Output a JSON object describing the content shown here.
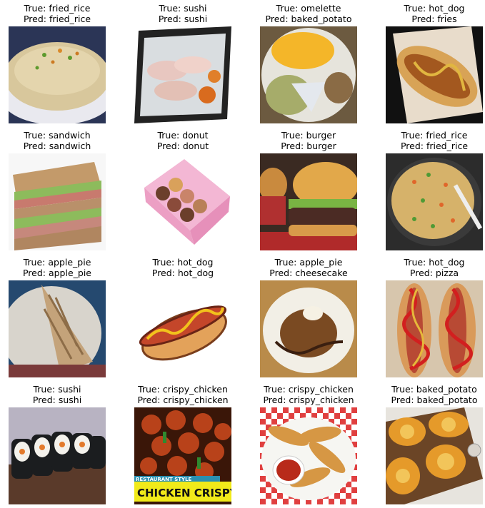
{
  "panels": [
    {
      "true_text": "True: fried_rice",
      "pred_text": "Pred: fried_rice",
      "image": "fried-rice-bowl"
    },
    {
      "true_text": "True: sushi",
      "pred_text": "Pred: sushi",
      "image": "sushi-plate"
    },
    {
      "true_text": "True: omelette",
      "pred_text": "Pred: baked_potato",
      "image": "omelette-plate"
    },
    {
      "true_text": "True: hot_dog",
      "pred_text": "Pred: fries",
      "image": "hot-dog-photo"
    },
    {
      "true_text": "True: sandwich",
      "pred_text": "Pred: sandwich",
      "image": "sandwich-stack"
    },
    {
      "true_text": "True: donut",
      "pred_text": "Pred: donut",
      "image": "donut-box"
    },
    {
      "true_text": "True: burger",
      "pred_text": "Pred: burger",
      "image": "burger-photo"
    },
    {
      "true_text": "True: fried_rice",
      "pred_text": "Pred: fried_rice",
      "image": "fried-rice-pan"
    },
    {
      "true_text": "True: apple_pie",
      "pred_text": "Pred: apple_pie",
      "image": "apple-pie-slice"
    },
    {
      "true_text": "True: hot_dog",
      "pred_text": "Pred: hot_dog",
      "image": "hot-dog-cartoon"
    },
    {
      "true_text": "True: apple_pie",
      "pred_text": "Pred: cheesecake",
      "image": "apple-pie-plate"
    },
    {
      "true_text": "True: hot_dog",
      "pred_text": "Pred: pizza",
      "image": "hot-dogs-ketchup"
    },
    {
      "true_text": "True: sushi",
      "pred_text": "Pred: sushi",
      "image": "sushi-rolls"
    },
    {
      "true_text": "True: crispy_chicken",
      "pred_text": "Pred: crispy_chicken",
      "image": "crispy-chicken-dish",
      "overlay_top": "RESTAURANT STYLE",
      "overlay_main": "CHICKEN CRISPY"
    },
    {
      "true_text": "True: crispy_chicken",
      "pred_text": "Pred: crispy_chicken",
      "image": "chicken-tenders"
    },
    {
      "true_text": "True: baked_potato",
      "pred_text": "Pred: baked_potato",
      "image": "baked-potatoes"
    }
  ]
}
